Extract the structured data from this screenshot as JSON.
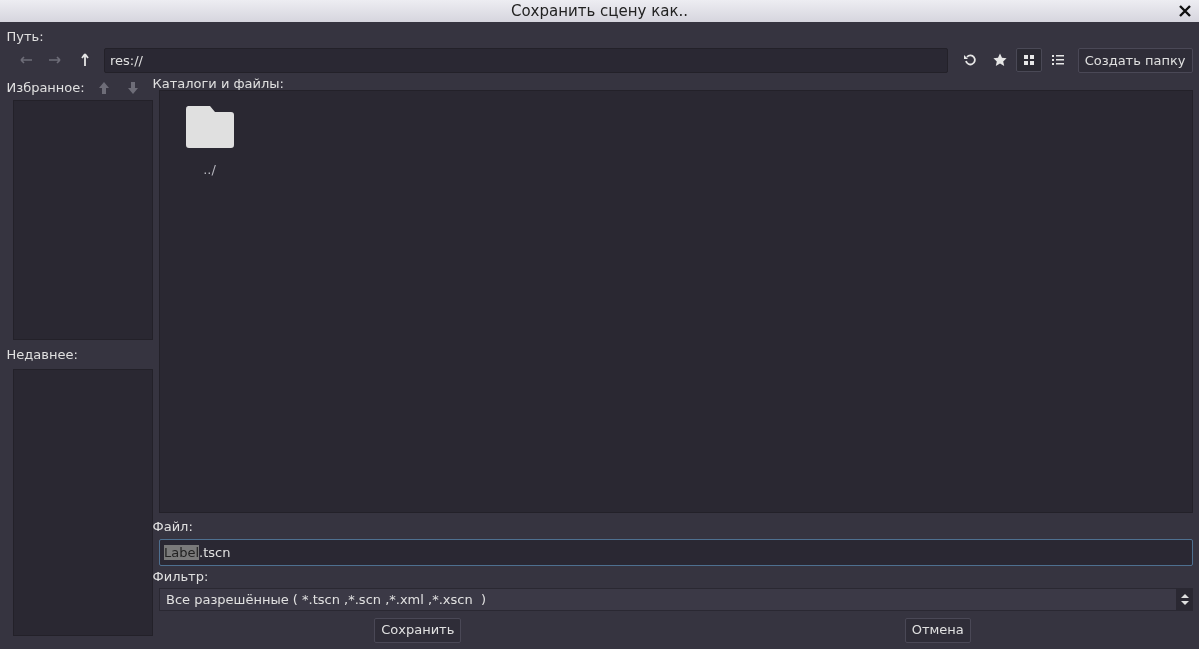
{
  "window": {
    "title": "Сохранить сцену как.."
  },
  "path": {
    "label": "Путь:",
    "value": "res://"
  },
  "nav_buttons": [
    {
      "kind": "back",
      "disabled": true
    },
    {
      "kind": "forward",
      "disabled": true
    },
    {
      "kind": "up",
      "disabled": false
    }
  ],
  "toolbar": {
    "view_modes": [
      {
        "kind": "grid",
        "selected": true
      },
      {
        "kind": "list",
        "selected": false
      }
    ],
    "create_folder": "Создать папку"
  },
  "favorites": {
    "label": "Избранное:",
    "move_buttons": [
      {
        "kind": "up",
        "disabled": true
      },
      {
        "kind": "down",
        "disabled": true
      }
    ]
  },
  "recent": {
    "label": "Недавнее:"
  },
  "files": {
    "label": "Каталоги и файлы:",
    "items": [
      {
        "name": "../",
        "kind": "folder"
      }
    ]
  },
  "file_field": {
    "label": "Файл:",
    "selected_text": "Label",
    "rest_text": ".tscn"
  },
  "filter": {
    "label": "Фильтр:",
    "value": "Все разрешённые ( *.tscn ,*.scn ,*.xml ,*.xscn  )"
  },
  "buttons": [
    "Сохранить",
    "Отмена"
  ]
}
